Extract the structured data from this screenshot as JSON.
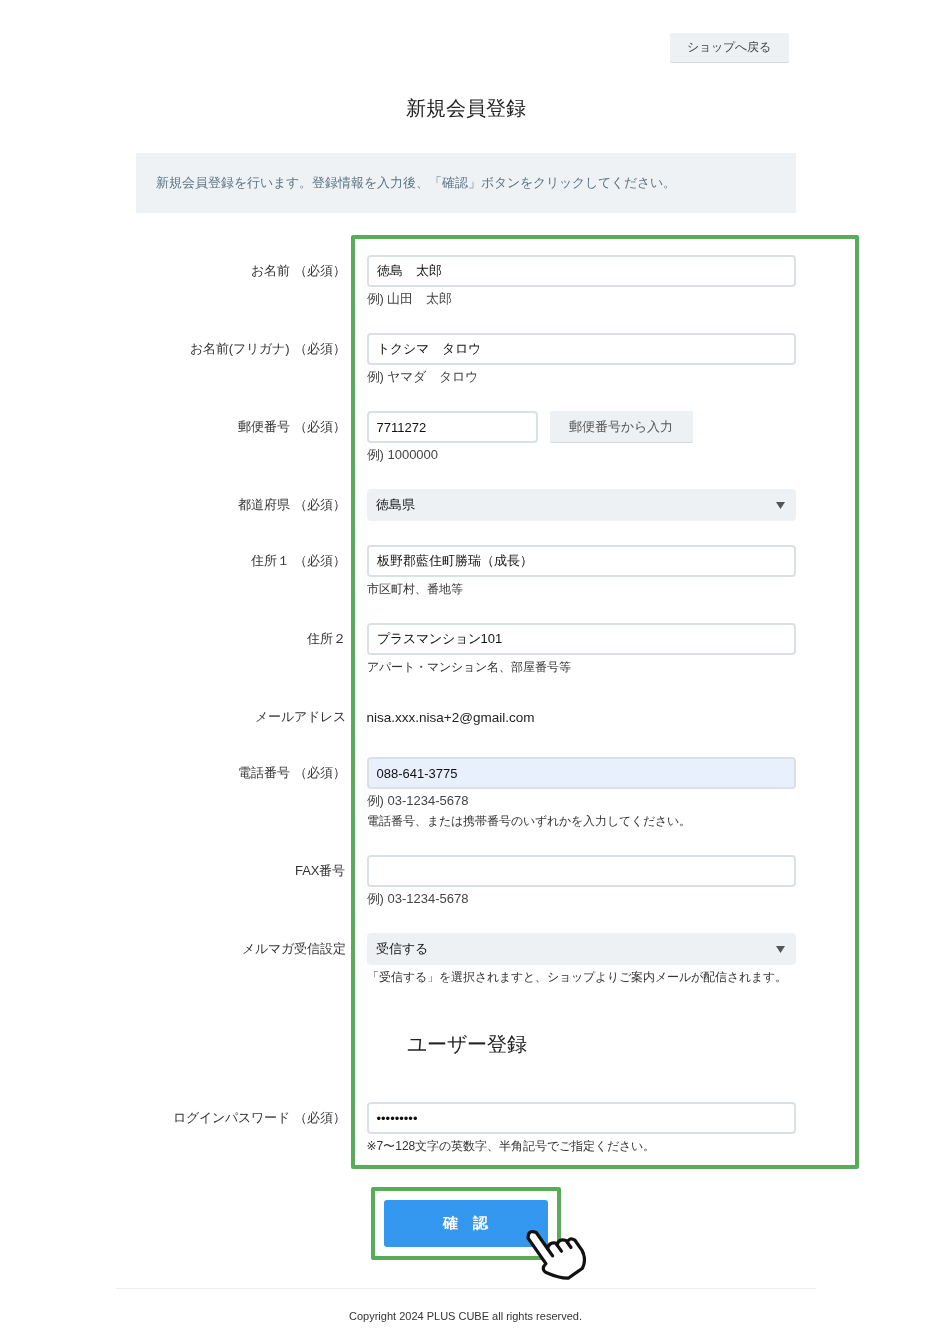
{
  "header": {
    "back_button": "ショップへ戻る"
  },
  "page_title": "新規会員登録",
  "notice": "新規会員登録を行います。登録情報を入力後、「確認」ボタンをクリックしてください。",
  "form_rows": [
    {
      "kind": "text",
      "label": "お名前",
      "required_mark": "（必須）",
      "value": "徳島　太郎",
      "autofilled": false,
      "hints": [
        {
          "kind": "example",
          "text": "例) 山田　太郎"
        }
      ]
    },
    {
      "kind": "text",
      "label": "お名前(フリガナ)",
      "required_mark": "（必須）",
      "value": "トクシマ　タロウ",
      "autofilled": false,
      "hints": [
        {
          "kind": "example",
          "text": "例) ヤマダ　タロウ"
        }
      ]
    },
    {
      "kind": "zip",
      "label": "郵便番号",
      "required_mark": "（必須）",
      "value": "7711272",
      "autofilled": false,
      "button": "郵便番号から入力",
      "hints": [
        {
          "kind": "example",
          "text": "例) 1000000"
        }
      ]
    },
    {
      "kind": "select",
      "label": "都道府県",
      "required_mark": "（必須）",
      "value": "徳島県"
    },
    {
      "kind": "text",
      "label": "住所１",
      "required_mark": "（必須）",
      "value": "板野郡藍住町勝瑞（成長）",
      "autofilled": false,
      "hints": [
        {
          "kind": "note",
          "text": "市区町村、番地等"
        }
      ]
    },
    {
      "kind": "text",
      "label": "住所２",
      "value": "プラスマンション101",
      "autofilled": false,
      "hints": [
        {
          "kind": "note",
          "text": "アパート・マンション名、部屋番号等"
        }
      ]
    },
    {
      "kind": "static",
      "label": "メールアドレス",
      "value": "nisa.xxx.nisa+2@gmail.com"
    },
    {
      "kind": "text",
      "label": "電話番号",
      "required_mark": "（必須）",
      "value": "088-641-3775",
      "autofilled": true,
      "hints": [
        {
          "kind": "example",
          "text": "例) 03-1234-5678"
        },
        {
          "kind": "note",
          "text": "電話番号、または携帯番号のいずれかを入力してください。"
        }
      ]
    },
    {
      "kind": "text",
      "label": "FAX番号",
      "autofilled": false,
      "hints": [
        {
          "kind": "example",
          "text": "例) 03-1234-5678"
        }
      ]
    },
    {
      "kind": "select",
      "label": "メルマガ受信設定",
      "value": "受信する",
      "hints": [
        {
          "kind": "note",
          "text": "「受信する」を選択されますと、ショップよりご案内メールが配信されます。"
        }
      ]
    },
    {
      "kind": "heading",
      "text": "ユーザー登録"
    },
    {
      "kind": "password",
      "label": "ログインパスワード",
      "required_mark": "（必須）",
      "value": "•••••••••",
      "autofilled": false,
      "hints": [
        {
          "kind": "note",
          "text": "※7〜128文字の英数字、半角記号でご指定ください。"
        }
      ]
    }
  ],
  "confirm_button": "確　認",
  "footer": {
    "copyright": "Copyright 2024 PLUS CUBE all rights reserved."
  }
}
